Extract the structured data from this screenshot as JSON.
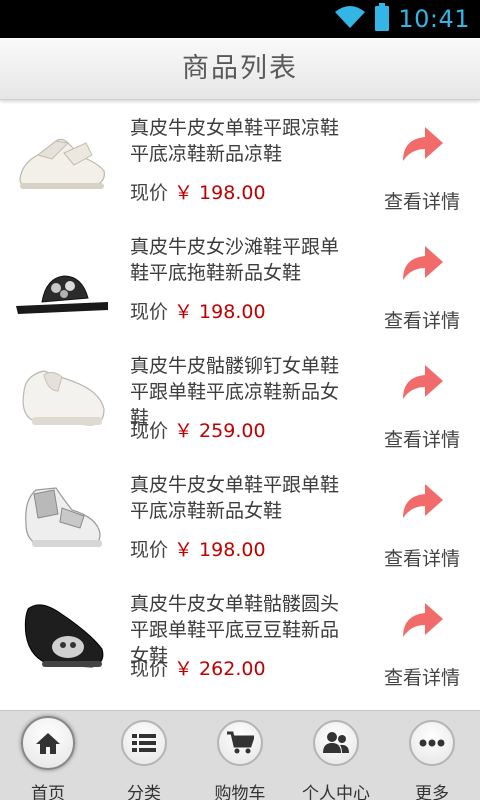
{
  "status_bar": {
    "time": "10:41",
    "icons": [
      "wifi-icon",
      "battery-icon"
    ]
  },
  "header": {
    "title": "商品列表"
  },
  "products": [
    {
      "name": "真皮牛皮女单鞋平跟凉鞋平底凉鞋新品凉鞋",
      "price_label": "现价",
      "price": "￥ 198.00",
      "action_label": "查看详情"
    },
    {
      "name": "真皮牛皮女沙滩鞋平跟单鞋平底拖鞋新品女鞋",
      "price_label": "现价",
      "price": "￥ 198.00",
      "action_label": "查看详情"
    },
    {
      "name": "真皮牛皮骷髅铆钉女单鞋平跟单鞋平底凉鞋新品女鞋",
      "price_label": "现价",
      "price": "￥ 259.00",
      "action_label": "查看详情"
    },
    {
      "name": "真皮牛皮女单鞋平跟单鞋平底凉鞋新品女鞋",
      "price_label": "现价",
      "price": "￥ 198.00",
      "action_label": "查看详情"
    },
    {
      "name": "真皮牛皮女单鞋骷髅圆头平跟单鞋平底豆豆鞋新品女鞋",
      "price_label": "现价",
      "price": "￥ 262.00",
      "action_label": "查看详情"
    }
  ],
  "bottom_nav": {
    "items": [
      {
        "label": "首页",
        "icon": "home-icon",
        "active": true
      },
      {
        "label": "分类",
        "icon": "list-icon",
        "active": false
      },
      {
        "label": "购物车",
        "icon": "cart-icon",
        "active": false
      },
      {
        "label": "个人中心",
        "icon": "user-icon",
        "active": false
      },
      {
        "label": "更多",
        "icon": "more-icon",
        "active": false
      }
    ]
  },
  "colors": {
    "price": "#c00000",
    "action_arrow": "#f26b6b",
    "status_accent": "#33b5e5",
    "nav_background": "#dcdcdc"
  }
}
